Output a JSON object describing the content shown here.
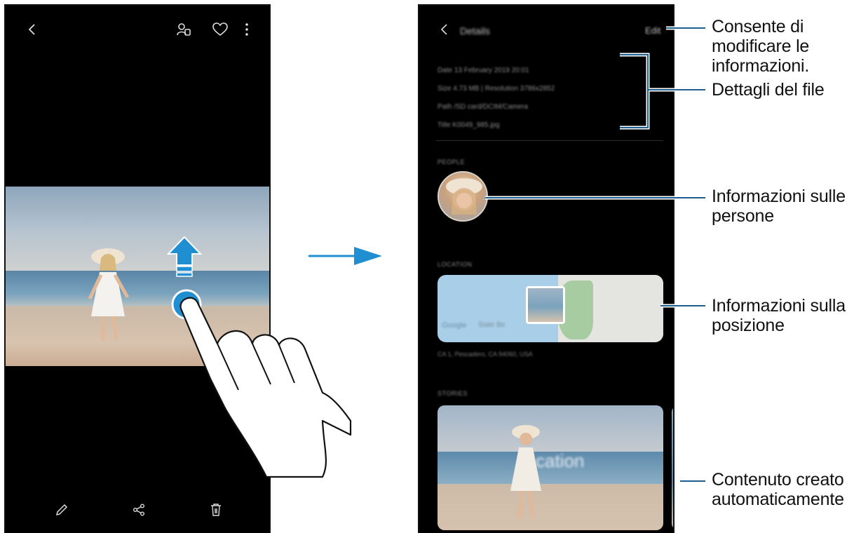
{
  "left_phone": {
    "top_bar": {
      "back_icon": "chevron-left-icon",
      "tag_people_icon": "tag-people-icon",
      "favorite_icon": "heart-icon",
      "more_icon": "more-vertical-icon"
    },
    "bottom_bar": {
      "edit_icon": "pencil-icon",
      "share_icon": "share-icon",
      "delete_icon": "trash-icon"
    },
    "gesture": "swipe-up"
  },
  "right_phone": {
    "header": {
      "title": "Details",
      "edit": "Edit"
    },
    "details": [
      "Date   13 February 2019 20:01",
      "Size   4.73 MB    |    Resolution   3786x2852",
      "Path   /SD card/DCIM/Camera",
      "Title   K0049_985.jpg"
    ],
    "sections": {
      "people": "PEOPLE",
      "location": "LOCATION",
      "stories": "STORIES"
    },
    "map": {
      "brand": "Google",
      "label": "State Be",
      "address": "CA 1, Pescadero, CA 94060, USA"
    },
    "story_overlay": "cation"
  },
  "callouts": {
    "edit": [
      "Consente di",
      "modificare le",
      "informazioni."
    ],
    "file_details": [
      "Dettagli del file"
    ],
    "people": [
      "Informazioni sulle",
      "persone"
    ],
    "location": [
      "Informazioni sulla",
      "posizione"
    ],
    "stories": [
      "Contenuto creato",
      "automaticamente"
    ]
  },
  "colors": {
    "accent": "#1f8fd1",
    "callout_line": "#1f5f8f"
  }
}
